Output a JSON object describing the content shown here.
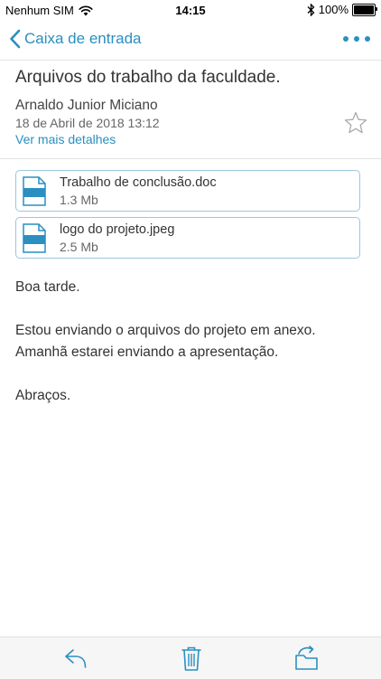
{
  "status_bar": {
    "carrier": "Nenhum SIM",
    "time": "14:15",
    "battery": "100%",
    "battery_level": 1.0
  },
  "nav": {
    "back_label": "Caixa de entrada",
    "more_icon": "ellipsis-icon"
  },
  "message": {
    "subject": "Arquivos do trabalho da faculdade.",
    "sender": "Arnaldo Junior Miciano",
    "date": "18 de Abril de 2018 13:12",
    "details_link": "Ver mais detalhes",
    "starred": false
  },
  "attachments": [
    {
      "name": "Trabalho de conclusão.doc",
      "size": "1.3 Mb",
      "icon": "file-icon"
    },
    {
      "name": "logo do projeto.jpeg",
      "size": "2.5 Mb",
      "icon": "file-icon"
    }
  ],
  "body": {
    "greeting": "Boa tarde.",
    "line1": "Estou enviando o arquivos do projeto em anexo.",
    "line2": "Amanhã estarei enviando a apresentação.",
    "closing": "Abraços."
  },
  "toolbar": {
    "reply_icon": "reply-icon",
    "delete_icon": "trash-icon",
    "move_icon": "move-folder-icon"
  },
  "colors": {
    "accent": "#2a8fc1",
    "attachment_border": "#9cc6de",
    "file_icon": "#2a8fc1"
  }
}
